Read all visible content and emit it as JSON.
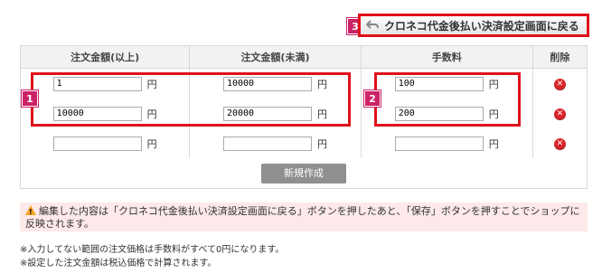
{
  "back_button": {
    "badge": "3",
    "label": "クロネコ代金後払い決済設定画面に戻る"
  },
  "table": {
    "headers": [
      "注文金額(以上)",
      "注文金額(未満)",
      "手数料",
      "削除"
    ],
    "currency": "円",
    "rows": [
      {
        "from": "1",
        "to": "10000",
        "fee": "100"
      },
      {
        "from": "10000",
        "to": "20000",
        "fee": "200"
      },
      {
        "from": "",
        "to": "",
        "fee": ""
      }
    ],
    "delete_symbol": "✕",
    "create_label": "新規作成"
  },
  "badges": {
    "left": "1",
    "right": "2"
  },
  "notice": "編集した内容は「クロネコ代金後払い決済設定画面に戻る」ボタンを押したあと、「保存」ボタンを押すことでショップに反映されます。",
  "notes": [
    "※入力してない範囲の注文価格は手数料がすべて0円になります。",
    "※設定した注文金額は税込価格で計算されます。"
  ],
  "colors": {
    "highlight": "#e0101a",
    "badge": "#cc2266",
    "notice_bg": "#fde9e9"
  }
}
